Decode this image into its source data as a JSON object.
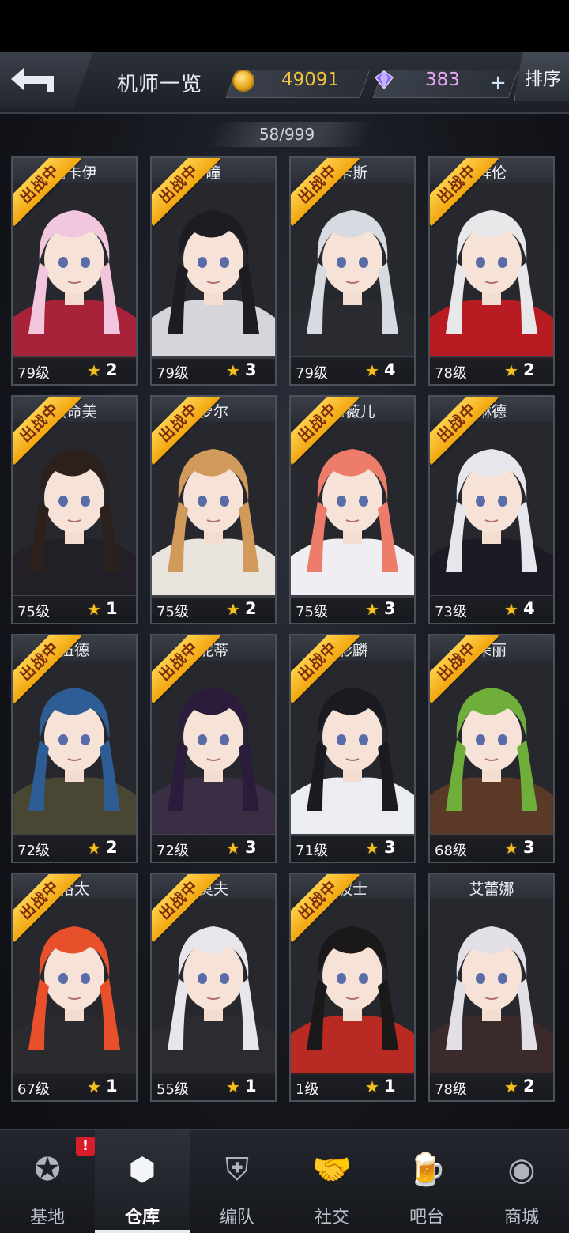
{
  "header": {
    "title": "机师一览",
    "gold": "49091",
    "gems": "383",
    "plus_label": "+",
    "sort_label": "排序",
    "back_icon": "back-arrow-icon"
  },
  "roster": {
    "count": "58/999",
    "badge_label": "出战中",
    "level_suffix": "级",
    "cards": [
      {
        "name": "洛卡伊",
        "level": "79级",
        "stars": "2",
        "deployed": true,
        "hair": "#f2c6dc",
        "outfit": "#a8223a"
      },
      {
        "name": "瞳",
        "level": "79级",
        "stars": "3",
        "deployed": true,
        "hair": "#1c1c22",
        "outfit": "#d6d6da"
      },
      {
        "name": "卡斯",
        "level": "79级",
        "stars": "4",
        "deployed": true,
        "hair": "#d8dae2",
        "outfit": "#2a2b31"
      },
      {
        "name": "拜伦",
        "level": "78级",
        "stars": "2",
        "deployed": true,
        "hair": "#e8e8ea",
        "outfit": "#b81c22"
      },
      {
        "name": "岚命美",
        "level": "75级",
        "stars": "1",
        "deployed": true,
        "hair": "#2b201c",
        "outfit": "#221f26"
      },
      {
        "name": "萝尔",
        "level": "75级",
        "stars": "2",
        "deployed": true,
        "hair": "#d29a5a",
        "outfit": "#e9e4de"
      },
      {
        "name": "尼薇儿",
        "level": "75级",
        "stars": "3",
        "deployed": true,
        "hair": "#ee7c6a",
        "outfit": "#f0eef2"
      },
      {
        "name": "琳德",
        "level": "73级",
        "stars": "4",
        "deployed": true,
        "hair": "#e6e6ec",
        "outfit": "#1e1a24"
      },
      {
        "name": "伍德",
        "level": "72级",
        "stars": "2",
        "deployed": true,
        "hair": "#2d5d94",
        "outfit": "#4a4634"
      },
      {
        "name": "妮蒂",
        "level": "72级",
        "stars": "3",
        "deployed": true,
        "hair": "#2a1c3a",
        "outfit": "#3a2e44"
      },
      {
        "name": "影麟",
        "level": "71级",
        "stars": "3",
        "deployed": true,
        "hair": "#1a1a20",
        "outfit": "#ecedf0"
      },
      {
        "name": "朵丽",
        "level": "68级",
        "stars": "3",
        "deployed": true,
        "hair": "#6fae3a",
        "outfit": "#5a3a26"
      },
      {
        "name": "裕太",
        "level": "67级",
        "stars": "1",
        "deployed": true,
        "hair": "#e8502c",
        "outfit": "#2b2a2e"
      },
      {
        "name": "莫夫",
        "level": "55级",
        "stars": "1",
        "deployed": true,
        "hair": "#e8e6ea",
        "outfit": "#2c2c30"
      },
      {
        "name": "波士",
        "level": "1级",
        "stars": "1",
        "deployed": true,
        "hair": "#1a1818",
        "outfit": "#b82a22"
      },
      {
        "name": "艾蕾娜",
        "level": "78级",
        "stars": "2",
        "deployed": false,
        "hair": "#e2e0e6",
        "outfit": "#3a2a2c"
      }
    ]
  },
  "nav": {
    "items": [
      {
        "label": "基地",
        "icon": "base-emblem-icon",
        "glyph": "✪",
        "active": false,
        "alert": "!"
      },
      {
        "label": "仓库",
        "icon": "warehouse-cube-icon",
        "glyph": "⬢",
        "active": true
      },
      {
        "label": "编队",
        "icon": "team-formation-icon",
        "glyph": "⛨",
        "active": false
      },
      {
        "label": "社交",
        "icon": "handshake-icon",
        "glyph": "🤝",
        "active": false
      },
      {
        "label": "吧台",
        "icon": "beer-mug-icon",
        "glyph": "🍺",
        "active": false
      },
      {
        "label": "商城",
        "icon": "shop-icon",
        "glyph": "◉",
        "active": false
      }
    ]
  },
  "colors": {
    "gold_text": "#f3c53a",
    "gem_text": "#e7a9f5",
    "badge": "#f1a60f",
    "star": "#f5c022"
  }
}
